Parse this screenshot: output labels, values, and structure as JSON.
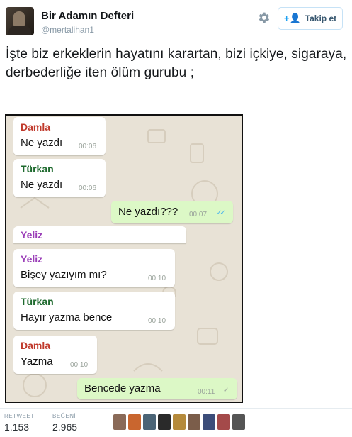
{
  "header": {
    "display_name": "Bir Adamın Defteri",
    "handle": "@mertalihan1",
    "follow_label": "Takip et"
  },
  "tweet_text": "İşte biz erkeklerin hayatını karartan, bizi içkiye, sigaraya, derbederliğe iten ölüm gurubu ;",
  "chat": {
    "messages": [
      {
        "sender": "Damla",
        "sender_color": "#c0392b",
        "text": "Ne yazdı",
        "time": "00:06"
      },
      {
        "sender": "Türkan",
        "sender_color": "#1e6a2e",
        "text": "Ne yazdı",
        "time": "00:06"
      },
      {
        "sender": "",
        "text": "Ne yazdı???",
        "time": "00:07",
        "outgoing": true
      },
      {
        "sender": "Yeliz",
        "sender_color": "#9b3fb8",
        "text": "",
        "time": "",
        "partial": true
      },
      {
        "sender": "Yeliz",
        "sender_color": "#9b3fb8",
        "text": "Bişey yazıyım mı?",
        "time": "00:10"
      },
      {
        "sender": "Türkan",
        "sender_color": "#1e6a2e",
        "text": "Hayır yazma bence",
        "time": "00:10"
      },
      {
        "sender": "Damla",
        "sender_color": "#c0392b",
        "text": "Yazma",
        "time": "00:10"
      },
      {
        "sender": "",
        "text": "Bencede yazma",
        "time": "00:11",
        "outgoing": true
      }
    ]
  },
  "stats": {
    "retweet_label": "RETWEET",
    "retweet_count": "1.153",
    "like_label": "BEĞENİ",
    "like_count": "2.965"
  },
  "colors": {
    "link": "#1da1f2",
    "chat_bg": "#e8e2d6",
    "outgoing_bubble": "#dcf8c6"
  }
}
